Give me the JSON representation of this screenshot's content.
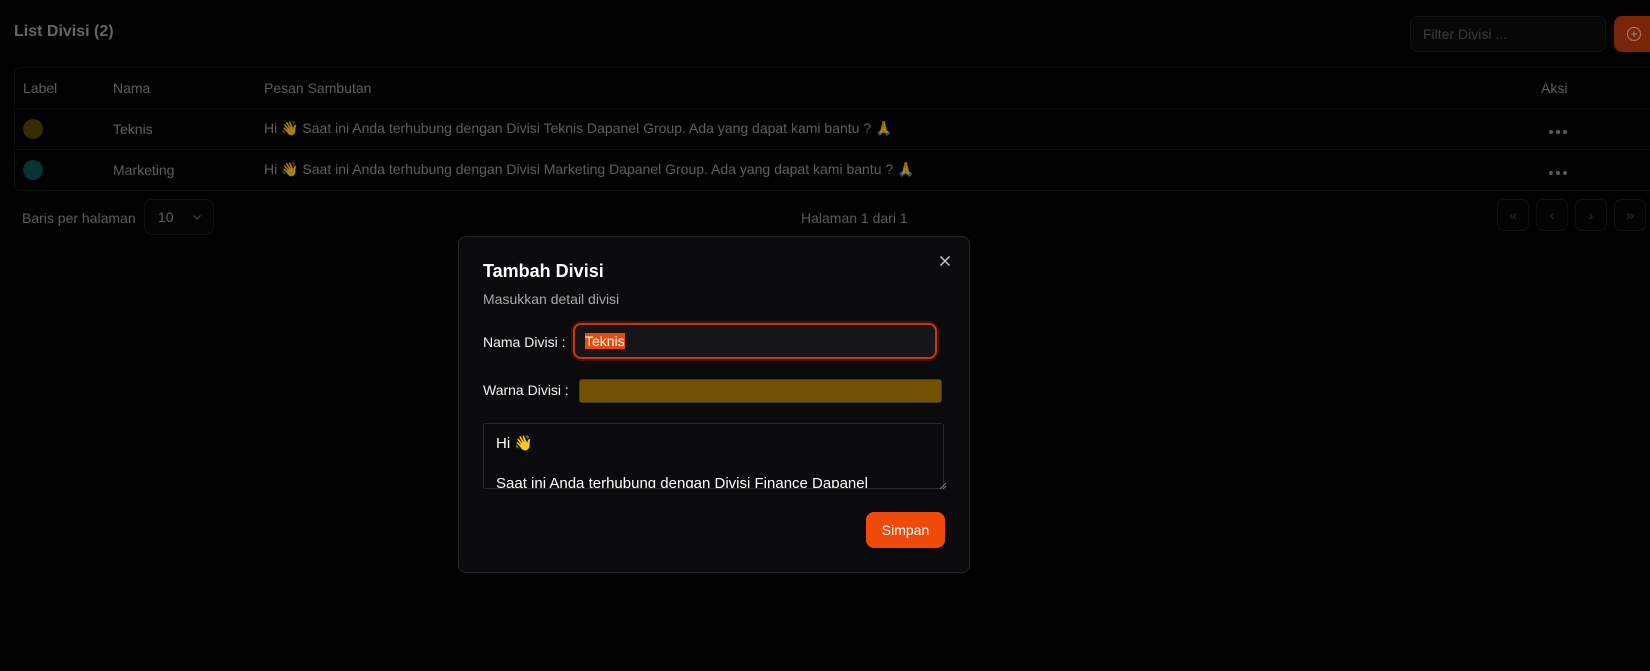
{
  "header": {
    "title": "List Divisi (2)",
    "filter_placeholder": "Filter Divisi ...",
    "add_icon": "plus-circle-icon"
  },
  "table": {
    "columns": [
      "Label",
      "Nama",
      "Pesan Sambutan",
      "Aksi"
    ],
    "rows": [
      {
        "color": "#5a3f08",
        "nama": "Teknis",
        "pesan": "Hi 👋 Saat ini Anda terhubung dengan Divisi Teknis Dapanel Group. Ada yang dapat kami bantu ? 🙏"
      },
      {
        "color": "#0d4f52",
        "nama": "Marketing",
        "pesan": "Hi 👋 Saat ini Anda terhubung dengan Divisi Marketing Dapanel Group. Ada yang dapat kami bantu ? 🙏"
      }
    ]
  },
  "pagination": {
    "rows_label": "Baris per halaman",
    "rows_value": "10",
    "page_info": "Halaman 1 dari 1",
    "first": "«",
    "prev": "‹",
    "next": "›",
    "last": "»"
  },
  "dialog": {
    "title": "Tambah Divisi",
    "subtitle": "Masukkan detail divisi",
    "nama_label": "Nama Divisi :",
    "nama_value": "Teknis",
    "warna_label": "Warna Divisi :",
    "warna_value": "#735104",
    "pesan_value": "Hi 👋\n\nSaat ini Anda terhubung dengan Divisi Finance Dapanel",
    "submit_label": "Simpan"
  },
  "colors": {
    "accent": "#f04a0b",
    "background": "#030303"
  }
}
